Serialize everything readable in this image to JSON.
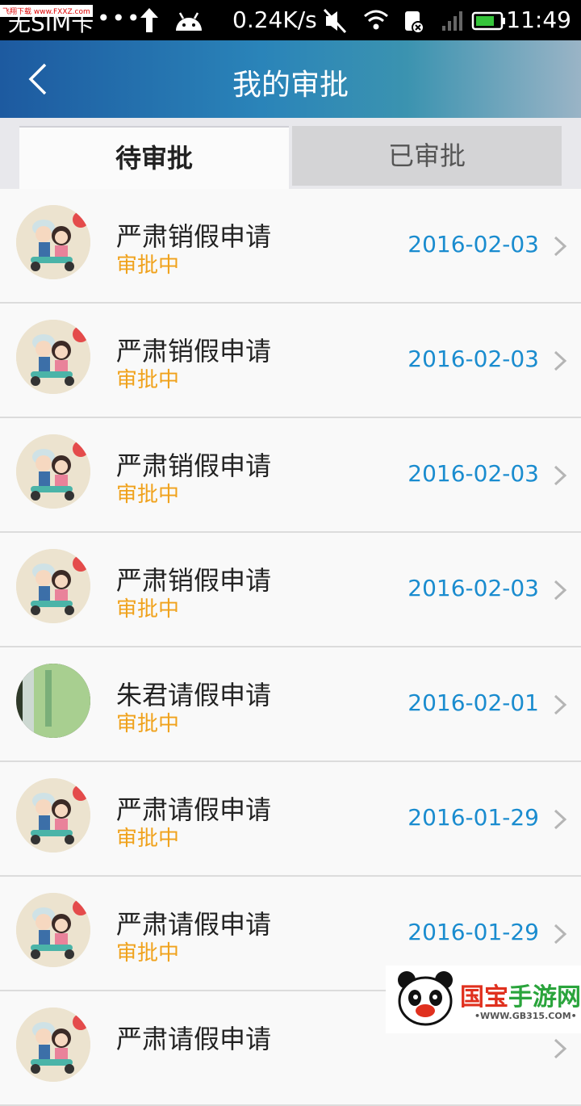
{
  "status_bar": {
    "carrier": "无SIM卡",
    "watermark": "飞翔下载 www.FXXZ.com",
    "dots": "•••",
    "speed": "0.24K/s",
    "time": "11:49"
  },
  "header": {
    "title": "我的审批"
  },
  "tabs": [
    {
      "label": "待审批",
      "active": true
    },
    {
      "label": "已审批",
      "active": false
    }
  ],
  "items": [
    {
      "title": "严肃销假申请",
      "status": "审批中",
      "date": "2016-02-03",
      "avatar": "cartoon"
    },
    {
      "title": "严肃销假申请",
      "status": "审批中",
      "date": "2016-02-03",
      "avatar": "cartoon"
    },
    {
      "title": "严肃销假申请",
      "status": "审批中",
      "date": "2016-02-03",
      "avatar": "cartoon"
    },
    {
      "title": "严肃销假申请",
      "status": "审批中",
      "date": "2016-02-03",
      "avatar": "cartoon"
    },
    {
      "title": "朱君请假申请",
      "status": "审批中",
      "date": "2016-02-01",
      "avatar": "photo"
    },
    {
      "title": "严肃请假申请",
      "status": "审批中",
      "date": "2016-01-29",
      "avatar": "cartoon"
    },
    {
      "title": "严肃请假申请",
      "status": "审批中",
      "date": "2016-01-29",
      "avatar": "cartoon"
    },
    {
      "title": "严肃请假申请",
      "status": "",
      "date": "",
      "avatar": "cartoon"
    }
  ],
  "brand": {
    "name_a": "国宝",
    "name_b": "手游网",
    "url": "•WWW.GB315.COM•"
  },
  "colors": {
    "status": "#f0a21c",
    "date": "#1a8ccf",
    "header_start": "#1d5aa0"
  }
}
